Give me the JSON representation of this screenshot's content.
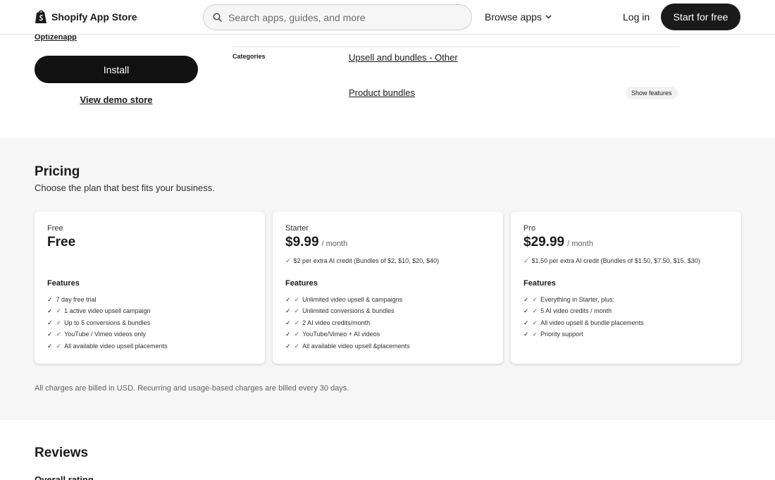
{
  "header": {
    "brand": "Shopify App Store",
    "search_placeholder": "Search apps, guides, and more",
    "browse_label": "Browse apps",
    "login_label": "Log in",
    "start_label": "Start for free"
  },
  "app": {
    "developer": "Optizenapp",
    "install_label": "Install",
    "demo_label": "View demo store"
  },
  "categories": {
    "label": "Categories",
    "items": [
      "Upsell and bundles - Other",
      "Product bundles"
    ],
    "show_features_label": "Show features"
  },
  "pricing": {
    "title": "Pricing",
    "subtitle": "Choose the plan that best fits your business.",
    "plans": [
      {
        "name": "Free",
        "price": "Free",
        "unit": "",
        "credit": "",
        "features_title": "Features",
        "features": [
          "7 day free trial",
          "1 active video upsell campaign",
          "Up to 5 conversions & bundles",
          "YouTube / Vimeo videos only",
          "All available video upsell placements"
        ]
      },
      {
        "name": "Starter",
        "price": "$9.99",
        "unit": "/ month",
        "credit": "$2 per extra AI credit (Bundles of $2, $10, $20, $40)",
        "features_title": "Features",
        "features": [
          "Unlimited video upsell & campaigns",
          "Unlimited conversions & bundles",
          "2 AI video credits/month",
          "YouTube/Vimeo + AI videos",
          "All available video upsell &placements"
        ]
      },
      {
        "name": "Pro",
        "price": "$29.99",
        "unit": "/ month",
        "credit": "$1.50 per extra AI credit (Bundles of $1.50, $7.50, $15, $30)",
        "features_title": "Features",
        "features": [
          "Everything in Starter, plus:",
          "5 AI video credits / month",
          "All video upsell & bundle placements",
          "Priority support"
        ]
      }
    ],
    "billing_note": "All charges are billed in USD. Recurring and usage-based charges are billed every 30 days."
  },
  "reviews": {
    "title": "Reviews",
    "overall_label": "Overall rating"
  },
  "icons": {
    "check": "✓"
  },
  "colors": {
    "primary_button": "#1a1a1a",
    "section_bg": "#f6f6f6",
    "text": "#303030"
  }
}
